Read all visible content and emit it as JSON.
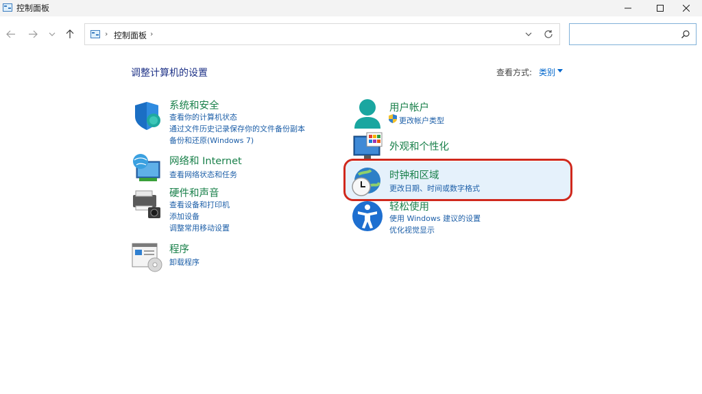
{
  "window": {
    "title": "控制面板"
  },
  "address": {
    "crumb": "控制面板",
    "sep": "›"
  },
  "search": {
    "placeholder": "",
    "value": ""
  },
  "header": {
    "heading": "调整计算机的设置",
    "view_by_label": "查看方式:",
    "view_by_value": "类别"
  },
  "left_categories": [
    {
      "title": "系统和安全",
      "icon": "shield-icon",
      "links": [
        "查看你的计算机状态",
        "通过文件历史记录保存你的文件备份副本",
        "备份和还原(Windows 7)"
      ]
    },
    {
      "title": "网络和 Internet",
      "icon": "network-globe-icon",
      "links": [
        "查看网络状态和任务"
      ]
    },
    {
      "title": "硬件和声音",
      "icon": "printer-icon",
      "links": [
        "查看设备和打印机",
        "添加设备",
        "调整常用移动设置"
      ]
    },
    {
      "title": "程序",
      "icon": "programs-icon",
      "links": [
        "卸载程序"
      ]
    }
  ],
  "right_categories": [
    {
      "title": "用户帐户",
      "icon": "user-icon",
      "links": [
        "更改帐户类型"
      ]
    },
    {
      "title": "外观和个性化",
      "icon": "appearance-icon",
      "links": []
    },
    {
      "title": "时钟和区域",
      "icon": "clock-globe-icon",
      "links": [
        "更改日期、时间或数字格式"
      ]
    },
    {
      "title": "轻松使用",
      "icon": "accessibility-icon",
      "links": [
        "使用 Windows 建议的设置",
        "优化视觉显示"
      ]
    }
  ],
  "colors": {
    "category_title": "#19804a",
    "link": "#1d5fa8",
    "heading": "#1e3287",
    "highlight": "#e5f1fb",
    "annotation_ring": "#d0281c"
  }
}
